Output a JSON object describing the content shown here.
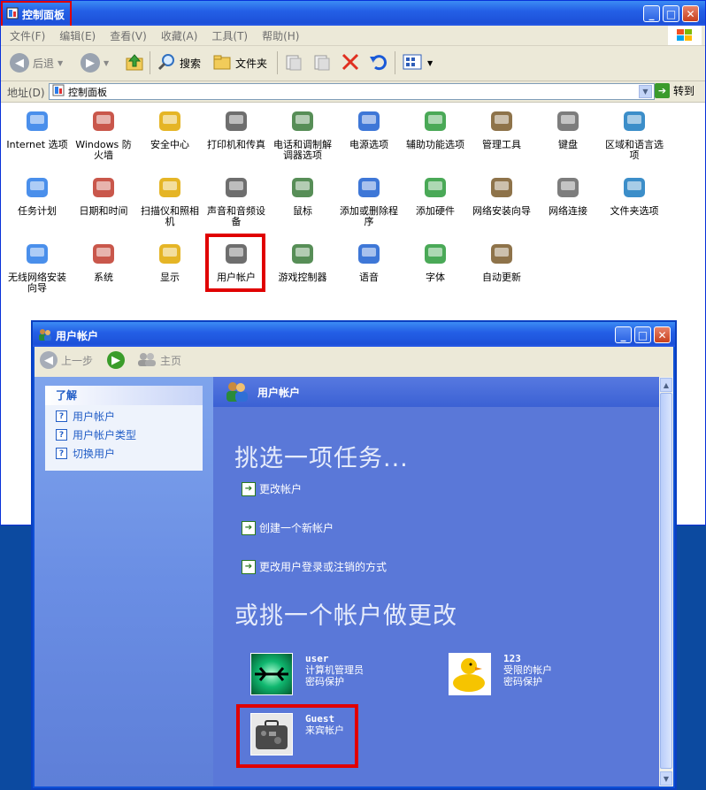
{
  "control_panel": {
    "title": "控制面板",
    "menu": [
      "文件(F)",
      "编辑(E)",
      "查看(V)",
      "收藏(A)",
      "工具(T)",
      "帮助(H)"
    ],
    "toolbar": {
      "back": "后退",
      "search": "搜索",
      "folders": "文件夹"
    },
    "address": {
      "label": "地址(D)",
      "value": "控制面板",
      "go": "转到"
    },
    "items": [
      {
        "label": "Internet 选项",
        "icon": "internet-options-icon"
      },
      {
        "label": "Windows 防火墙",
        "icon": "firewall-icon"
      },
      {
        "label": "安全中心",
        "icon": "security-center-icon"
      },
      {
        "label": "打印机和传真",
        "icon": "printer-icon"
      },
      {
        "label": "电话和调制解调器选项",
        "icon": "phone-modem-icon"
      },
      {
        "label": "电源选项",
        "icon": "power-options-icon"
      },
      {
        "label": "辅助功能选项",
        "icon": "accessibility-icon"
      },
      {
        "label": "管理工具",
        "icon": "admin-tools-icon"
      },
      {
        "label": "键盘",
        "icon": "keyboard-icon"
      },
      {
        "label": "区域和语言选项",
        "icon": "globe-icon"
      },
      {
        "label": "任务计划",
        "icon": "scheduled-tasks-icon"
      },
      {
        "label": "日期和时间",
        "icon": "clock-icon"
      },
      {
        "label": "扫描仪和照相机",
        "icon": "scanner-camera-icon"
      },
      {
        "label": "声音和音频设备",
        "icon": "speaker-icon"
      },
      {
        "label": "鼠标",
        "icon": "mouse-icon"
      },
      {
        "label": "添加或删除程序",
        "icon": "add-remove-programs-icon"
      },
      {
        "label": "添加硬件",
        "icon": "add-hardware-icon"
      },
      {
        "label": "网络安装向导",
        "icon": "network-setup-icon"
      },
      {
        "label": "网络连接",
        "icon": "network-connections-icon"
      },
      {
        "label": "文件夹选项",
        "icon": "folder-options-icon"
      },
      {
        "label": "无线网络安装向导",
        "icon": "wireless-icon"
      },
      {
        "label": "系统",
        "icon": "system-icon"
      },
      {
        "label": "显示",
        "icon": "display-icon"
      },
      {
        "label": "用户帐户",
        "icon": "user-accounts-icon"
      },
      {
        "label": "游戏控制器",
        "icon": "game-controller-icon"
      },
      {
        "label": "语音",
        "icon": "speech-icon"
      },
      {
        "label": "字体",
        "icon": "fonts-icon"
      },
      {
        "label": "自动更新",
        "icon": "automatic-updates-icon"
      }
    ]
  },
  "user_accounts": {
    "title": "用户帐户",
    "nav": {
      "back": "上一步",
      "home": "主页"
    },
    "learn": {
      "header": "了解",
      "links": [
        "用户帐户",
        "用户帐户类型",
        "切换用户"
      ]
    },
    "main": {
      "header": "用户帐户",
      "pick_task": "挑选一项任务...",
      "tasks": [
        "更改帐户",
        "创建一个新帐户",
        "更改用户登录或注销的方式"
      ],
      "pick_account": "或挑一个帐户做更改",
      "accounts": [
        {
          "name": "user",
          "type": "计算机管理员",
          "status": "密码保护"
        },
        {
          "name": "123",
          "type": "受限的帐户",
          "status": "密码保护"
        },
        {
          "name": "Guest",
          "type": "来宾帐户",
          "status": ""
        }
      ]
    }
  },
  "colors": {
    "xp_blue": "#2460e6",
    "highlight_red": "#e00000",
    "pane_blue": "#5a78d8"
  }
}
